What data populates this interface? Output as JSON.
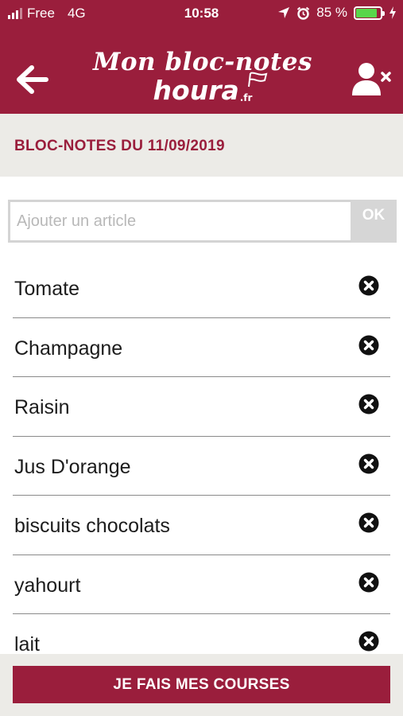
{
  "status_bar": {
    "carrier": "Free",
    "network": "4G",
    "time": "10:58",
    "battery_percent": "85 %",
    "battery_level": 0.85,
    "icons": [
      "signal-icon",
      "location-arrow-icon",
      "alarm-icon",
      "battery-icon",
      "charging-icon"
    ]
  },
  "header": {
    "back_icon": "arrow-left-icon",
    "logo_line1": "Mon bloc-notes",
    "logo_line2": "houra",
    "logo_suffix": ".fr",
    "user_icon": "user-remove-icon"
  },
  "page": {
    "title": "BLOC-NOTES DU 11/09/2019"
  },
  "add_article": {
    "placeholder": "Ajouter un article",
    "value": "",
    "ok_label": "OK"
  },
  "items": [
    {
      "label": "Tomate"
    },
    {
      "label": "Champagne"
    },
    {
      "label": "Raisin"
    },
    {
      "label": "Jus D'orange"
    },
    {
      "label": "biscuits chocolats"
    },
    {
      "label": "yahourt"
    },
    {
      "label": "lait"
    }
  ],
  "footer": {
    "cta_label": "JE FAIS MES COURSES"
  },
  "colors": {
    "brand": "#9a1e3c",
    "band": "#ecebe7",
    "battery_fill": "#58d64a"
  }
}
